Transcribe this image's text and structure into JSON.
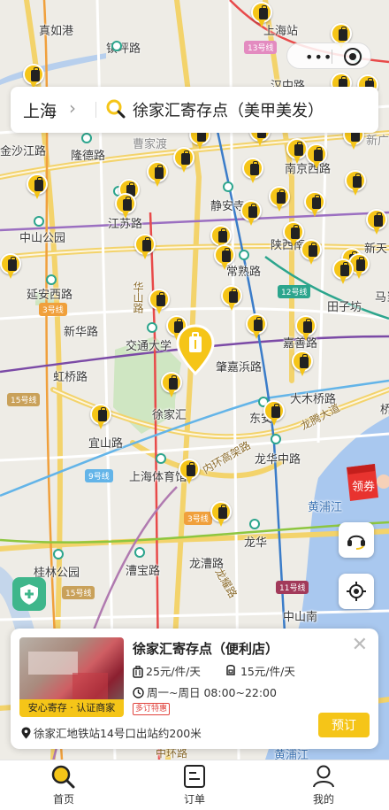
{
  "search": {
    "city": "上海",
    "query": "徐家汇寄存点（美甲美发）"
  },
  "map": {
    "labels": {
      "jianru_gang": "真如港",
      "zhenguang_lu": "镇坪路",
      "shanghai_station": "上海站",
      "line13": "13号线",
      "hankou_lu": "汉中路",
      "shajing": "金沙江路",
      "longde_lu": "隆德路",
      "caojiadu": "曹家渡",
      "zhongshan_park": "中山公园",
      "jiangsu_lu": "江苏路",
      "jingan_temple": "静安寺",
      "nanjing_xi": "南京西路",
      "shimen": "陕西南",
      "changshu_lu": "常熟路",
      "xinxin": "新天",
      "yanan_xi": "延安西路",
      "line3": "3号线",
      "xinhua_lu": "新华路",
      "huashan_lu": "华山路",
      "jiaotong_univ": "交通大学",
      "zhaojiabang": "肇嘉浜路",
      "jiashan_lu": "嘉善路",
      "line12": "12号线",
      "tianzifang": "田子坊",
      "hongqiao_lu": "虹桥路",
      "line15": "15号线",
      "xujiahui": "徐家汇",
      "dongan_lu": "东安",
      "damuqiao_lu": "大木桥路",
      "yishan_lu": "宜山路",
      "line9": "9号线",
      "inner_ring": "内环高架路",
      "longhua_middle": "龙华中路",
      "longteng": "龙腾大道",
      "stadium": "上海体育馆",
      "huangpu": "黄浦江",
      "line3b": "3号线",
      "longhua": "龙华",
      "guilin_park": "桂林公园",
      "caobao_lu": "漕宝路",
      "longcao_lu": "龙漕路",
      "line15b": "15号线",
      "line11": "11号线",
      "zhongshan_south": "中山南",
      "huangpu2": "黄浦江",
      "zhonghuan": "中环路",
      "longyao": "龙耀路",
      "xinguang": "新广场",
      "madang": "马当",
      "qiao": "桥"
    },
    "coupon_label": "领券"
  },
  "card": {
    "title": "徐家汇寄存点（便利店）",
    "price_small": "25元/件/天",
    "price_large": "15元/件/天",
    "hours": "周一~周日 08:00~22:00",
    "discount": "多订特惠",
    "badge": "安心寄存 · 认证商家",
    "address": "徐家汇地铁站14号口出站约200米",
    "book_label": "预订"
  },
  "tabbar": {
    "home": "首页",
    "orders": "订单",
    "mine": "我的"
  },
  "colors": {
    "brand_yellow": "#f5c518",
    "metro_green": "#2ca58d",
    "shield_green": "#3fb68b",
    "discount_red": "#e0443e"
  },
  "icons": [
    "luggage-pin-icon",
    "search-icon",
    "chevron-right-icon",
    "headset-icon",
    "locate-icon",
    "shield-plus-icon",
    "close-icon",
    "suitcase-icon",
    "backpack-icon",
    "clock-icon",
    "location-icon",
    "home-search-icon",
    "orders-icon",
    "user-icon",
    "coupon-icon"
  ]
}
